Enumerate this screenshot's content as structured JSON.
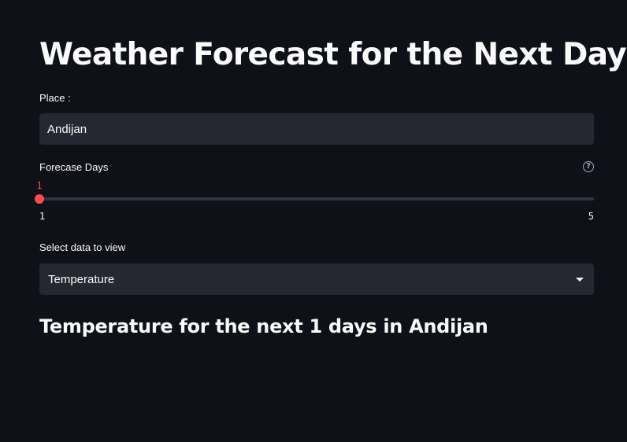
{
  "page": {
    "title": "Weather Forecast for the Next Days"
  },
  "place": {
    "label": "Place :",
    "value": "Andijan"
  },
  "forecast_days": {
    "label": "Forecase Days",
    "value": 1,
    "value_text": "1",
    "min": 1,
    "max": 5,
    "min_label": "1",
    "max_label": "5",
    "help_icon": "question-circle-icon"
  },
  "data_select": {
    "label": "Select data to view",
    "selected": "Temperature",
    "icon": "caret-down-icon"
  },
  "result": {
    "subheader": "Temperature for the next 1 days in Andijan"
  },
  "colors": {
    "background": "#0e1117",
    "input_background": "#262730",
    "accent": "#ff4b4b",
    "text": "#fafafa"
  }
}
